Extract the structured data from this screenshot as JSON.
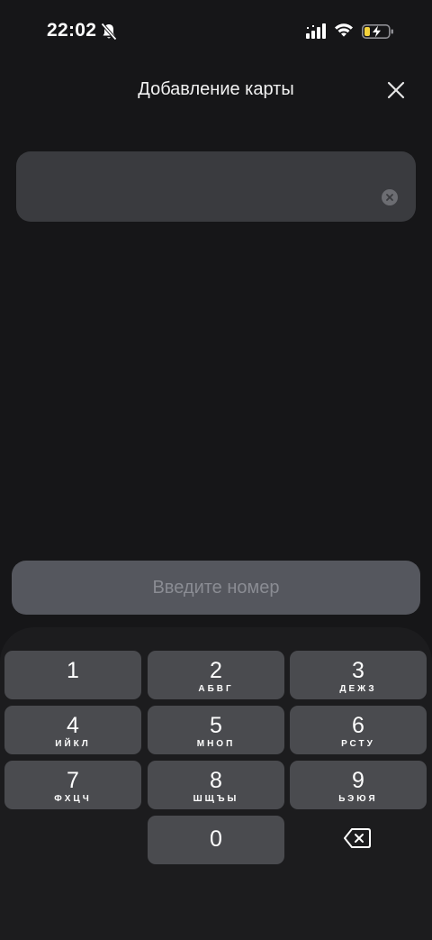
{
  "status_bar": {
    "time": "22:02"
  },
  "header": {
    "title": "Добавление карты"
  },
  "card_field": {
    "value": "",
    "placeholder": ""
  },
  "submit": {
    "label": "Введите номер"
  },
  "keypad": {
    "keys": [
      {
        "digit": "1",
        "letters": ""
      },
      {
        "digit": "2",
        "letters": "АБВГ"
      },
      {
        "digit": "3",
        "letters": "ДЕЖЗ"
      },
      {
        "digit": "4",
        "letters": "ИЙКЛ"
      },
      {
        "digit": "5",
        "letters": "МНОП"
      },
      {
        "digit": "6",
        "letters": "РСТУ"
      },
      {
        "digit": "7",
        "letters": "ФХЦЧ"
      },
      {
        "digit": "8",
        "letters": "ШЩЪЫ"
      },
      {
        "digit": "9",
        "letters": "ЬЭЮЯ"
      },
      {
        "digit": "0",
        "letters": ""
      }
    ]
  },
  "colors": {
    "background": "#161618",
    "field": "#3a3b3f",
    "key": "#4a4b4f",
    "submit_disabled": "#55575e",
    "battery_charge": "#f5d33b"
  },
  "icons": [
    "bell-slash-icon",
    "signal-icon",
    "wifi-icon",
    "battery-charging-icon",
    "close-icon",
    "clear-icon",
    "backspace-icon"
  ]
}
